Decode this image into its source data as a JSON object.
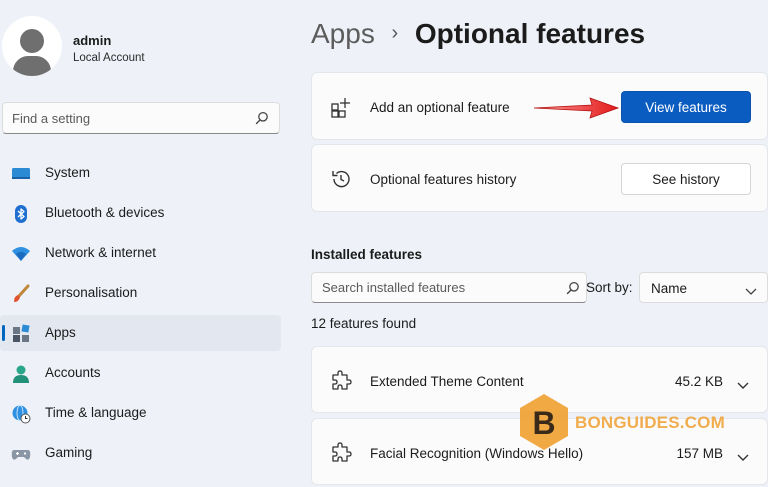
{
  "profile": {
    "name": "admin",
    "account_type": "Local Account"
  },
  "search": {
    "placeholder": "Find a setting"
  },
  "nav": {
    "items": [
      {
        "label": "System",
        "icon": "system-monitor-icon"
      },
      {
        "label": "Bluetooth & devices",
        "icon": "bluetooth-icon"
      },
      {
        "label": "Network & internet",
        "icon": "wifi-icon"
      },
      {
        "label": "Personalisation",
        "icon": "paintbrush-icon"
      },
      {
        "label": "Apps",
        "icon": "apps-icon",
        "active": true
      },
      {
        "label": "Accounts",
        "icon": "person-icon"
      },
      {
        "label": "Time & language",
        "icon": "globe-clock-icon"
      },
      {
        "label": "Gaming",
        "icon": "gamepad-icon"
      }
    ]
  },
  "breadcrumb": {
    "parent": "Apps",
    "separator": "›",
    "current": "Optional features"
  },
  "add_feature": {
    "label": "Add an optional feature",
    "button": "View features"
  },
  "history": {
    "label": "Optional features history",
    "button": "See history"
  },
  "installed": {
    "title": "Installed features",
    "search_placeholder": "Search installed features",
    "sort_label": "Sort by:",
    "sort_value": "Name",
    "count_text": "12 features found",
    "features": [
      {
        "name": "Extended Theme Content",
        "size": "45.2 KB"
      },
      {
        "name": "Facial Recognition (Windows Hello)",
        "size": "157 MB"
      }
    ]
  },
  "watermark": {
    "text": "BONGUIDES.COM",
    "badge_letter": "B"
  },
  "colors": {
    "accent": "#0b5cc1",
    "background": "#eef2f8",
    "card": "#fbfbfc",
    "annotation_arrow": "#e21b1b",
    "watermark": "#f0a030"
  }
}
